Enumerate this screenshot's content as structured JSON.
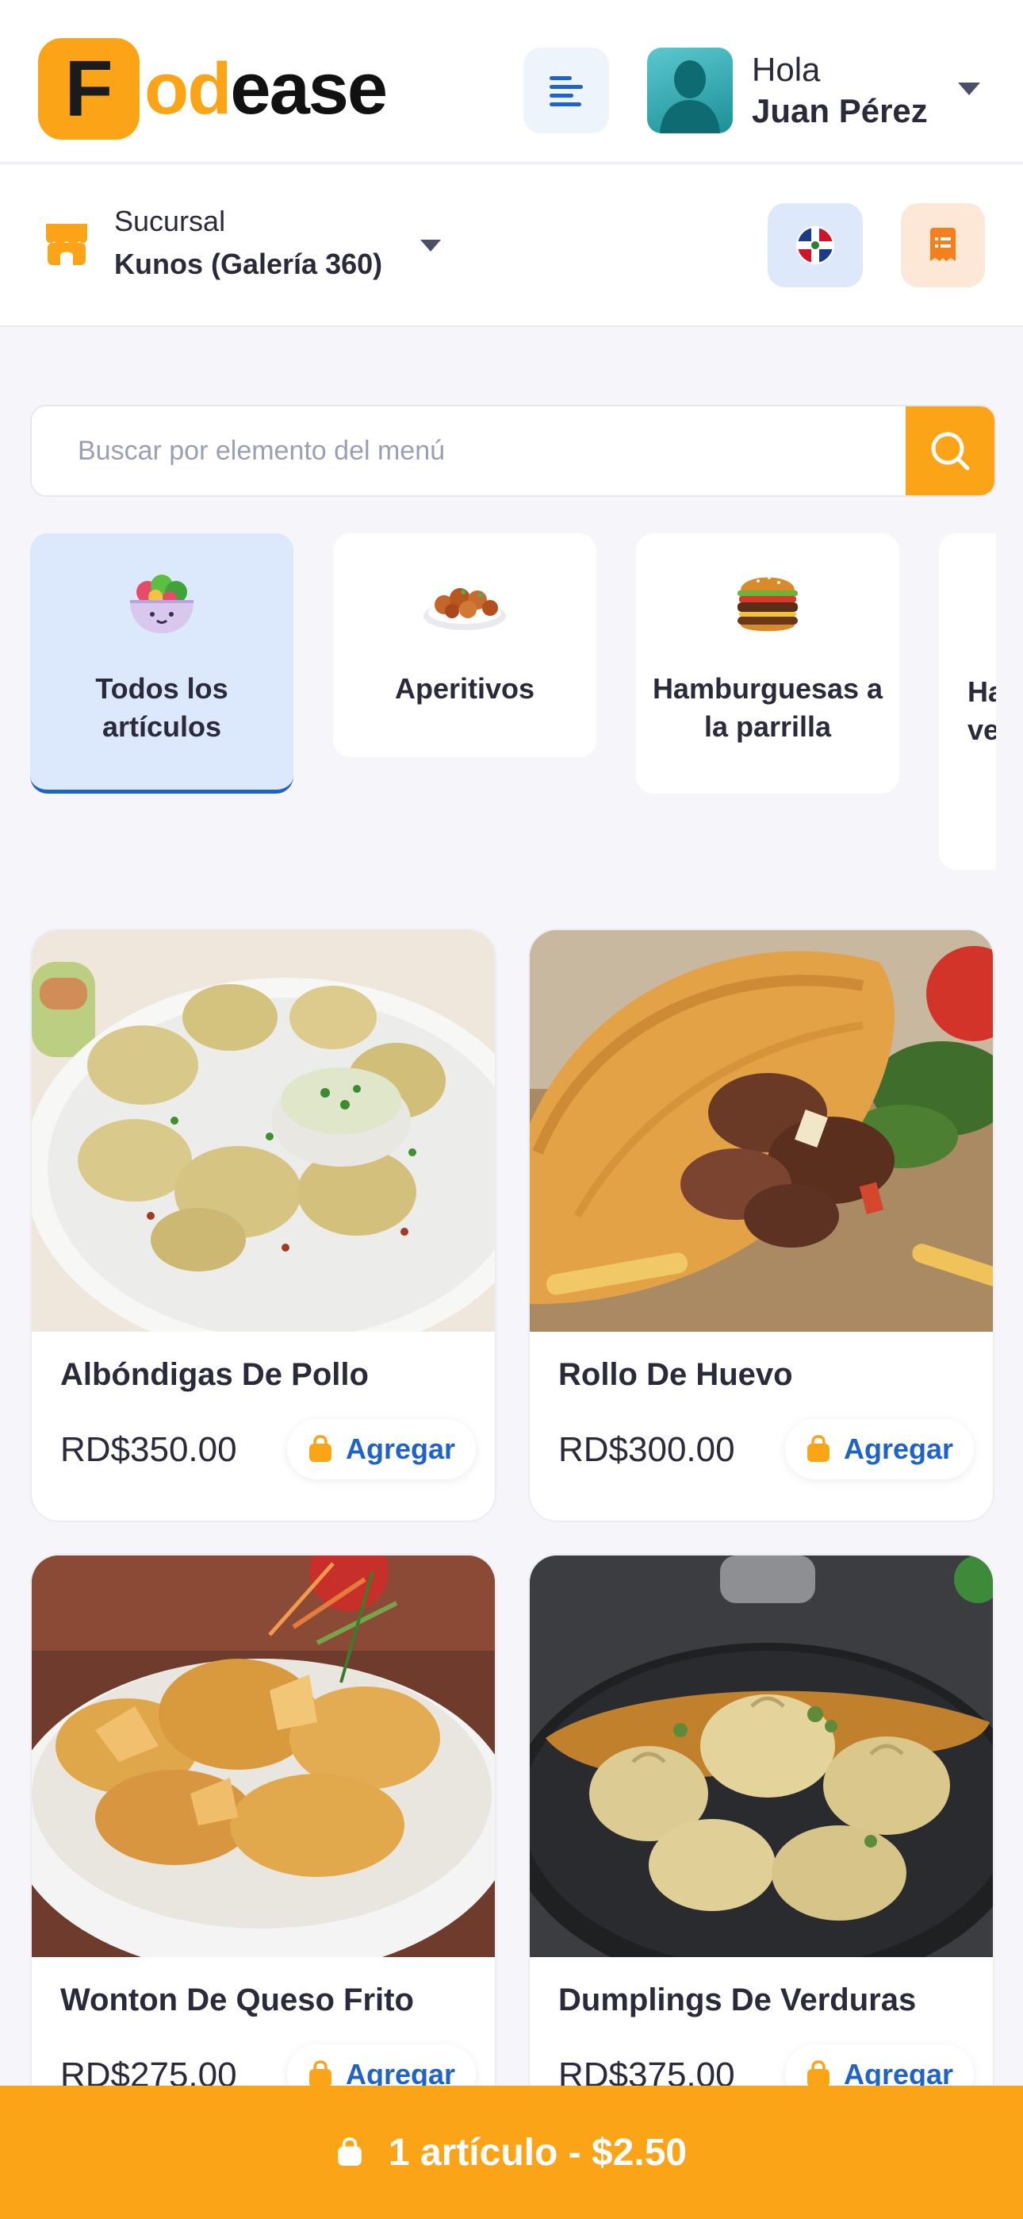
{
  "header": {
    "logo_first": "F",
    "logo_mid": "od",
    "logo_end": "ease",
    "greeting": "Hola",
    "user_name": "Juan Pérez"
  },
  "branch": {
    "label": "Sucursal",
    "name": "Kunos (Galería 360)"
  },
  "search": {
    "placeholder": "Buscar por elemento del menú"
  },
  "categories": [
    {
      "label": "Todos los artículos",
      "active": true,
      "icon": "salad-bowl-icon"
    },
    {
      "label": "Aperitivos",
      "active": false,
      "icon": "appetizer-plate-icon"
    },
    {
      "label": "Hamburguesas a la parrilla",
      "active": false,
      "icon": "burger-icon"
    },
    {
      "label": "Ha ve",
      "active": false,
      "icon": ""
    }
  ],
  "products": [
    {
      "name": "Albóndigas De Pollo",
      "price": "RD$350.00",
      "add_label": "Agregar"
    },
    {
      "name": "Rollo De Huevo",
      "price": "RD$300.00",
      "add_label": "Agregar"
    },
    {
      "name": "Wonton De Queso Frito",
      "price": "RD$275.00",
      "add_label": "Agregar"
    },
    {
      "name": "Dumplings De Verduras",
      "price": "RD$375.00",
      "add_label": "Agregar"
    }
  ],
  "cart": {
    "summary": "1 artículo - $2.50"
  },
  "colors": {
    "accent": "#fba417",
    "link": "#1f63c7",
    "active_category_bg": "#dce8fb"
  }
}
